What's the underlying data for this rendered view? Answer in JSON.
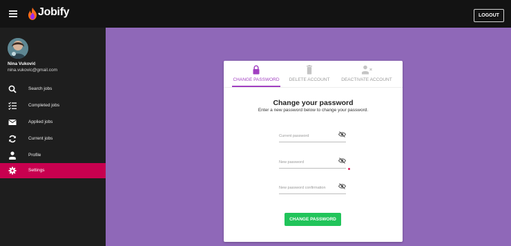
{
  "header": {
    "app_name": "Jobify",
    "logout_label": "LOGOUT",
    "menu_icon": "hamburger-icon",
    "logo_icon": "flame-icon"
  },
  "user": {
    "name": "Nina Vuković",
    "email": "nina.vukovic@gmail.com"
  },
  "sidebar": {
    "items": [
      {
        "label": "Search jobs",
        "icon": "search-icon",
        "active": false
      },
      {
        "label": "Completed jobs",
        "icon": "checklist-icon",
        "active": false
      },
      {
        "label": "Applied jobs",
        "icon": "envelope-icon",
        "active": false
      },
      {
        "label": "Current jobs",
        "icon": "refresh-icon",
        "active": false
      },
      {
        "label": "Profile",
        "icon": "person-icon",
        "active": false
      },
      {
        "label": "Settings",
        "icon": "gear-icon",
        "active": true
      }
    ]
  },
  "tabs": [
    {
      "label": "CHANGE PASSWORD",
      "icon": "lock-icon",
      "active": true
    },
    {
      "label": "DELETE ACCOUNT",
      "icon": "trash-icon",
      "active": false
    },
    {
      "label": "DEACTIVATE ACCOUNT",
      "icon": "person-remove-icon",
      "active": false
    }
  ],
  "form": {
    "title": "Change your password",
    "subtitle": "Enter a new password below to change your password.",
    "fields": [
      {
        "placeholder": "Current password",
        "value": ""
      },
      {
        "placeholder": "New password",
        "value": ""
      },
      {
        "placeholder": "New password confirmation",
        "value": ""
      }
    ],
    "submit_label": "CHANGE PASSWORD"
  },
  "colors": {
    "background": "#8f68b8",
    "topbar": "#131313",
    "sidebar": "#1e1e1e",
    "active_nav": "#c8004f",
    "accent": "#a13fc1",
    "button": "#21c45a"
  }
}
